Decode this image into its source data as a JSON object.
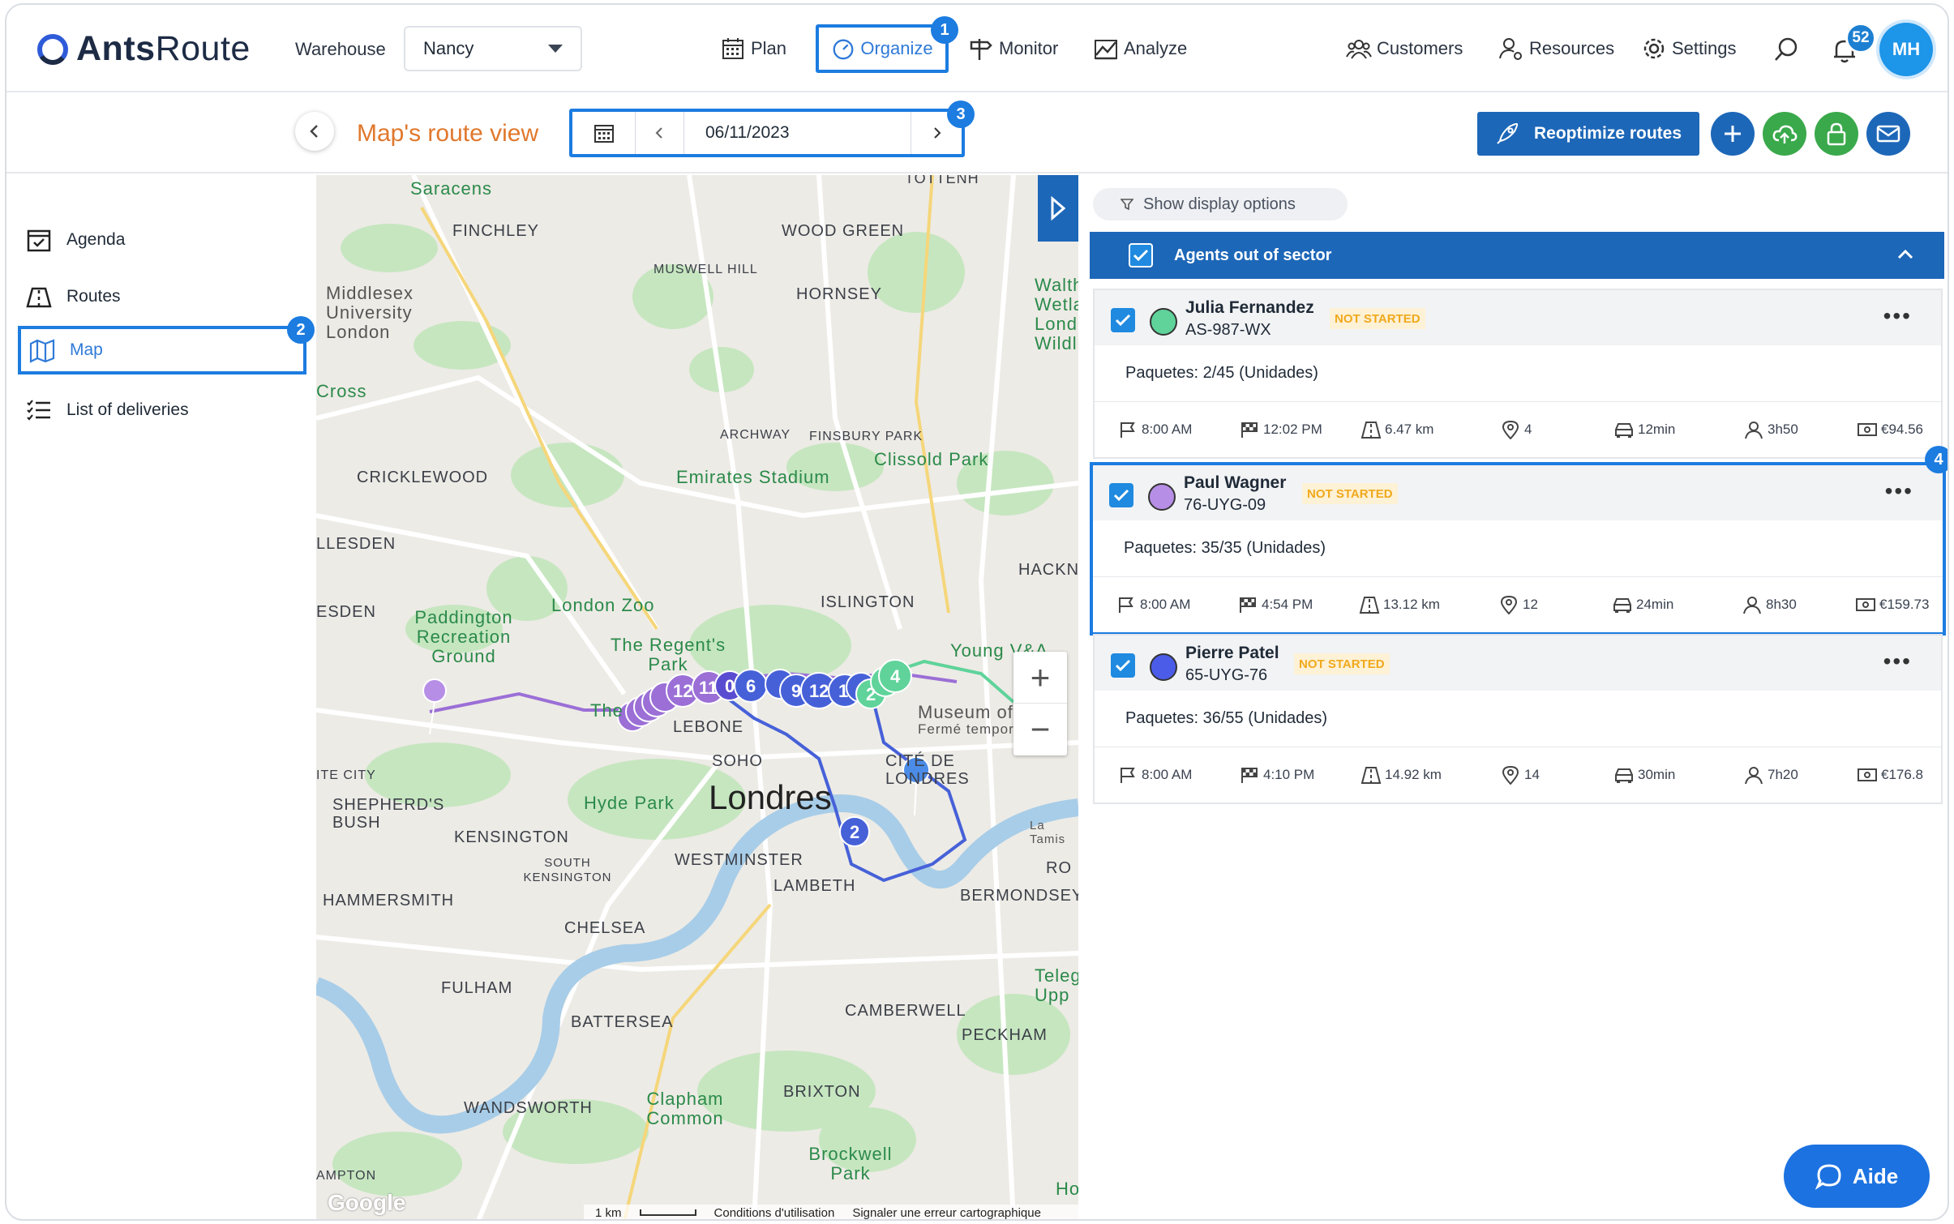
{
  "app": {
    "brand_a": "Ants",
    "brand_b": "Route"
  },
  "header": {
    "warehouse_label": "Warehouse",
    "warehouse_value": "Nancy",
    "nav": {
      "plan": "Plan",
      "organize": "Organize",
      "monitor": "Monitor",
      "analyze": "Analyze",
      "customers": "Customers",
      "resources": "Resources",
      "settings": "Settings"
    },
    "notifications": "52",
    "avatar": "MH",
    "badges": [
      "1",
      "2",
      "3",
      "4"
    ]
  },
  "subbar": {
    "title": "Map's route view",
    "date": "06/11/2023",
    "reoptimize": "Reoptimize routes"
  },
  "sidebar": {
    "items": [
      "Agenda",
      "Routes",
      "Map",
      "List of deliveries"
    ]
  },
  "map": {
    "labels": {
      "saracens": "Saracens",
      "finchley": "FINCHLEY",
      "wood_green": "WOOD GREEN",
      "muswell_hill": "MUSWELL HILL",
      "hornsey": "HORNSEY",
      "middlesex": "Middlesex University London",
      "cross": "Cross",
      "archway": "ARCHWAY",
      "finsbury_park": "FINSBURY PARK",
      "cricklewood": "CRICKLEWOOD",
      "emirates": "Emirates Stadium",
      "clissold": "Clissold Park",
      "llesden": "LLESDEN",
      "hackn": "HACKN",
      "london_zoo": "London Zoo",
      "islington": "ISLINGTON",
      "esden": "ESDEN",
      "paddington": "Paddington Recreation Ground",
      "regents": "The Regent's Park",
      "young": "Young V&A",
      "museum": "Museum of",
      "ferme": "Fermé tempora",
      "lebone": "LEBONE",
      "the": "The",
      "soho": "SOHO",
      "cite": "CITÉ DE LONDRES",
      "city": "ITE CITY",
      "shepherds": "SHEPHERD'S BUSH",
      "hyde": "Hyde Park",
      "londres": "Londres",
      "kensington": "KENSINGTON",
      "south_ken": "SOUTH KENSINGTON",
      "westminster": "WESTMINSTER",
      "lambeth": "LAMBETH",
      "ro": "RO",
      "bermondsey": "BERMONDSEY",
      "hammersmith": "HAMMERSMITH",
      "chelsea": "CHELSEA",
      "fulham": "FULHAM",
      "tele": "Teleg Upp",
      "camberwell": "CAMBERWELL",
      "battersea": "BATTERSEA",
      "peckham": "PECKHAM",
      "brixton": "BRIXTON",
      "wandsworth": "WANDSWORTH",
      "clapham": "Clapham Common",
      "brockwell": "Brockwell Park",
      "ampton": "AMPTON",
      "ho": "Ho",
      "totten": "TOTTENH",
      "waltham": "Waltham Wetla Lond Wildlif",
      "la_tamise": "La Tamis"
    },
    "pins": {
      "p12a": "12",
      "p11": "11",
      "p0": "0",
      "p6": "6",
      "p9": "9",
      "p12b": "12",
      "p1": "1",
      "p2g": "2",
      "p4": "4",
      "p2b": "2"
    },
    "zoom_in": "+",
    "zoom_out": "−",
    "footer": {
      "google": "Google",
      "scale": "1 km",
      "terms": "Conditions d'utilisation",
      "report": "Signaler une erreur cartographique"
    }
  },
  "panel": {
    "display_options": "Show display options",
    "sector_title": "Agents out of sector",
    "agents": [
      {
        "name": "Julia Fernandez",
        "plate": "AS-987-WX",
        "status": "NOT STARTED",
        "color": "#5fd39a",
        "packages": "Paquetes: 2/45 (Unidades)",
        "start": "8:00 AM",
        "end": "12:02 PM",
        "distance": "6.47 km",
        "stops": "4",
        "drive": "12min",
        "duration": "3h50",
        "cost": "€94.56"
      },
      {
        "name": "Paul Wagner",
        "plate": "76-UYG-09",
        "status": "NOT STARTED",
        "color": "#b68ee6",
        "packages": "Paquetes: 35/35 (Unidades)",
        "start": "8:00 AM",
        "end": "4:54 PM",
        "distance": "13.12 km",
        "stops": "12",
        "drive": "24min",
        "duration": "8h30",
        "cost": "€159.73"
      },
      {
        "name": "Pierre Patel",
        "plate": "65-UYG-76",
        "status": "NOT STARTED",
        "color": "#4b5de8",
        "packages": "Paquetes: 36/55 (Unidades)",
        "start": "8:00 AM",
        "end": "4:10 PM",
        "distance": "14.92 km",
        "stops": "14",
        "drive": "30min",
        "duration": "7h20",
        "cost": "€176.8"
      }
    ]
  },
  "help": {
    "label": "Aide"
  },
  "colors": {
    "accent": "#1c7ce0",
    "brand_dark": "#1d67b8",
    "title_orange": "#e0782d",
    "status_bg": "#fdf1d6",
    "status_fg": "#f0a91c"
  }
}
